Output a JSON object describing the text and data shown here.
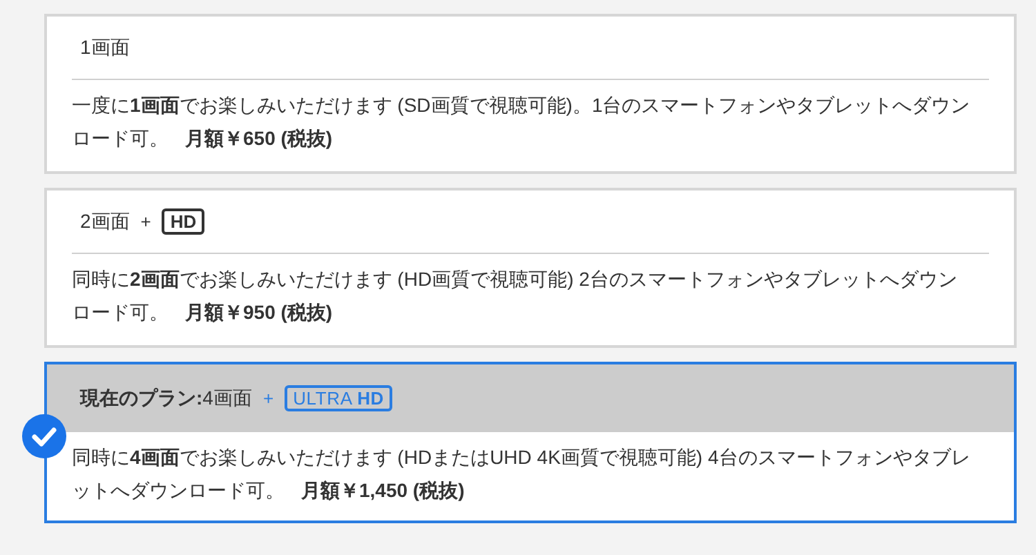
{
  "plans": [
    {
      "selected": false,
      "title": "1画面",
      "description": "一度に**1画面**でお楽しみいただけます (SD画質で視聴可能)。1台のスマートフォンやタブレットへダウンロード可。",
      "price": "月額￥650 (税抜)"
    },
    {
      "selected": false,
      "title": "2画面",
      "plus": "+",
      "badge": {
        "kind": "hd",
        "text": "HD"
      },
      "description": "同時に**2画面**でお楽しみいただけます (HD画質で視聴可能) 2台のスマートフォンやタブレットへダウンロード可。",
      "price": "月額￥950 (税抜)"
    },
    {
      "selected": true,
      "current_label": "現在のプラン:",
      "title": "4画面",
      "plus": "+",
      "badge": {
        "kind": "ultra_hd",
        "text": "ULTRA **HD**"
      },
      "description": "同時に**4画面**でお楽しみいただけます (HDまたはUHD 4K画質で視聴可能) 4台のスマートフォンやタブレットへダウンロード可。",
      "price": "月額￥1,450 (税抜)"
    }
  ]
}
